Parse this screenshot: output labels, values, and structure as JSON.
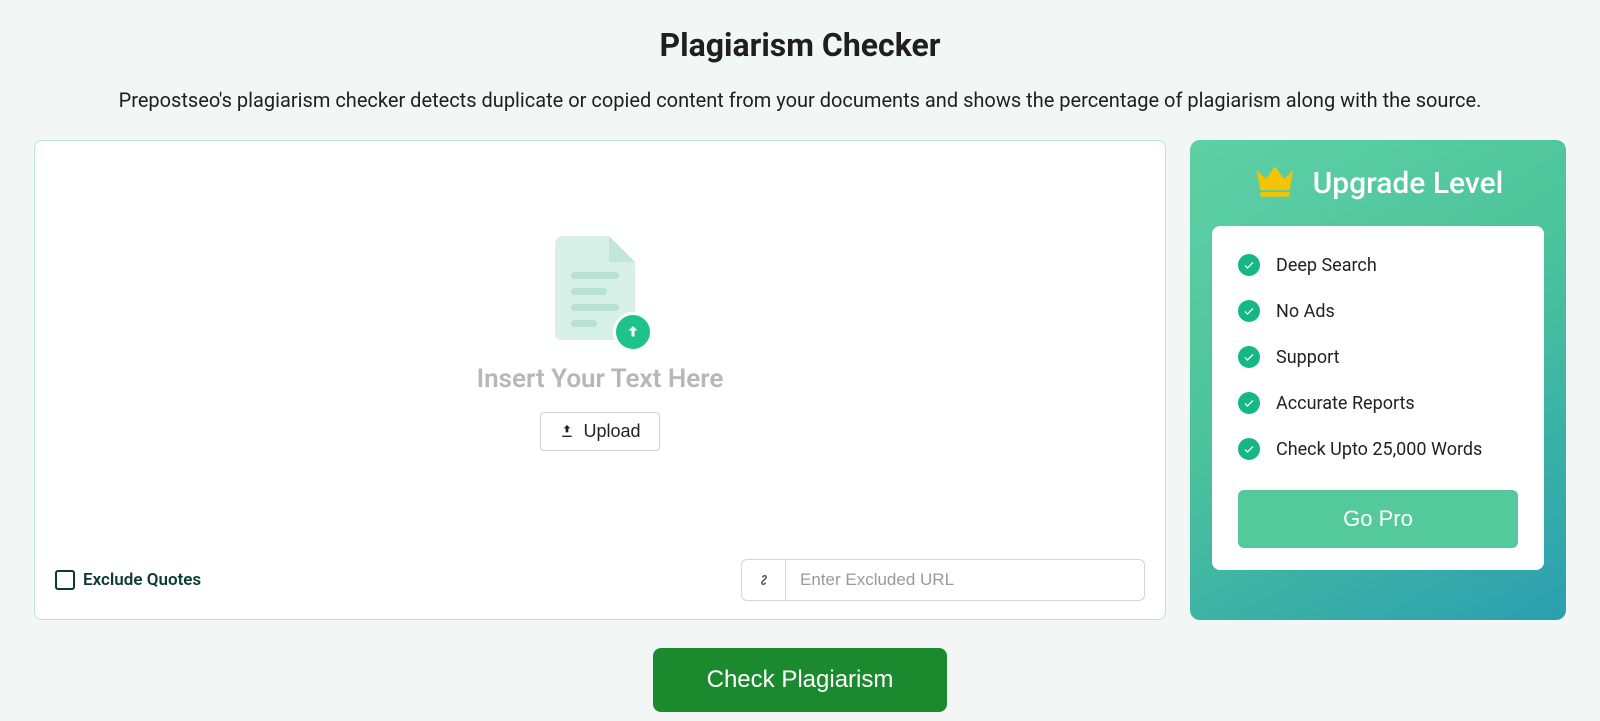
{
  "header": {
    "title": "Plagiarism Checker",
    "subtitle": "Prepostseo's plagiarism checker detects duplicate or copied content from your documents and shows the percentage of plagiarism along with the source."
  },
  "editor": {
    "placeholder_text": "Insert Your Text Here",
    "upload_label": "Upload",
    "exclude_quotes_label": "Exclude Quotes",
    "excluded_url_placeholder": "Enter Excluded URL"
  },
  "sidebar": {
    "title": "Upgrade Level",
    "features": [
      {
        "label": "Deep Search"
      },
      {
        "label": "No Ads"
      },
      {
        "label": "Support"
      },
      {
        "label": "Accurate Reports"
      },
      {
        "label": "Check Upto 25,000 Words"
      }
    ],
    "go_pro_label": "Go Pro"
  },
  "actions": {
    "check_label": "Check Plagiarism"
  }
}
